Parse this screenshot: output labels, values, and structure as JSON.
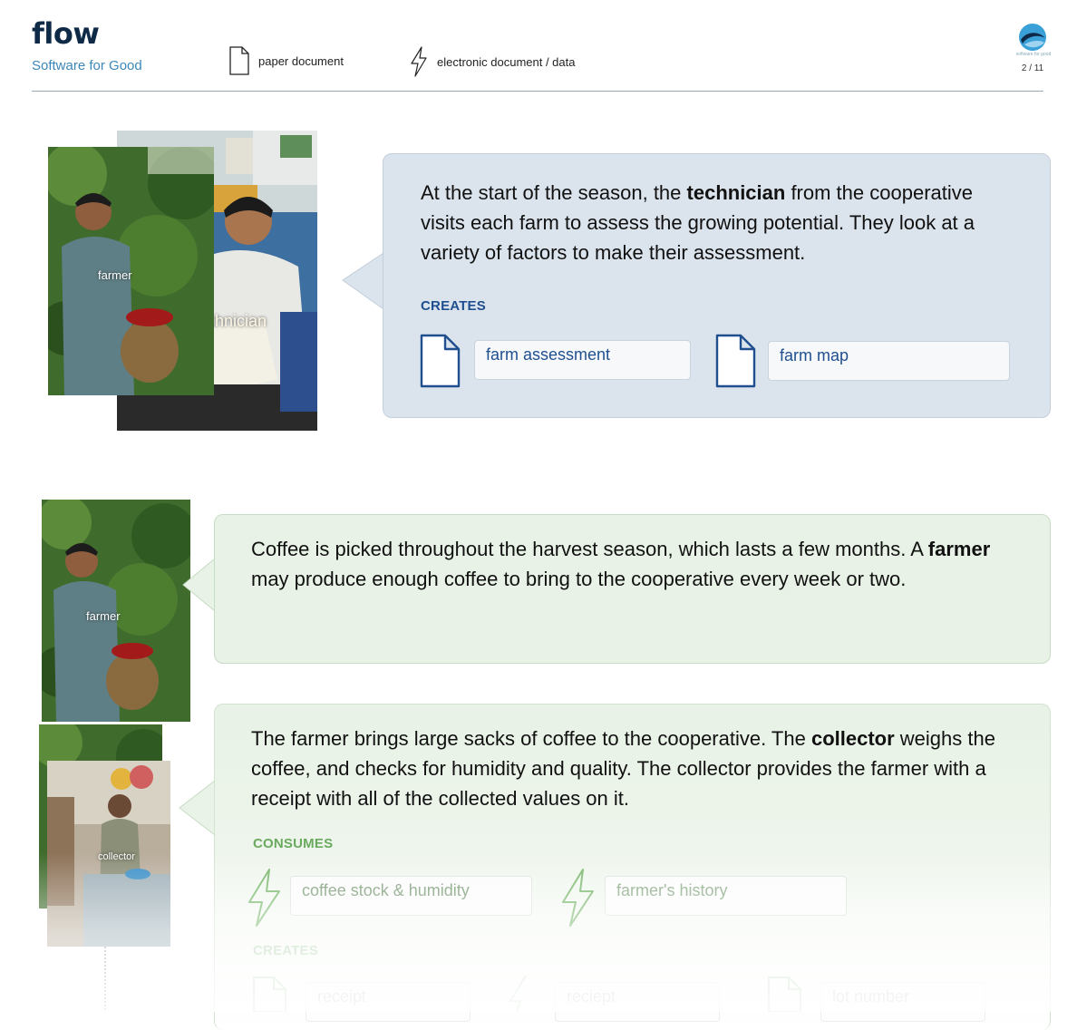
{
  "header": {
    "title": "flow",
    "subtitle": "Software for Good",
    "legend": {
      "paper_label": "paper document",
      "electronic_label": "electronic document / data"
    },
    "brand_tiny": "software for good",
    "page": "2 / 11"
  },
  "step1": {
    "photo_labels": {
      "farmer": "farmer",
      "technician": "technician"
    },
    "text_a": "At the start of the season, the ",
    "role": "technician",
    "text_b": " from the cooperative visits each farm to assess the growing potential. They look at a variety of factors to make their assessment.",
    "creates_label": "CREATES",
    "creates": [
      "farm assessment",
      "farm map"
    ]
  },
  "step2": {
    "photo_label": "farmer",
    "text_a": "Coffee is picked throughout the harvest season, which lasts a few months. A ",
    "role": "farmer",
    "text_b": " may produce enough coffee to bring to the cooperative every week or two."
  },
  "step3": {
    "photo_label": "collector",
    "text_a": "The farmer brings large sacks of coffee to the cooperative. The ",
    "role": "collector",
    "text_b": " weighs the coffee, and checks for humidity and quality. The collector provides the farmer with a receipt with all of the collected values on it.",
    "consumes_label": "CONSUMES",
    "consumes": [
      "coffee stock & humidity",
      "farmer's history"
    ],
    "creates_label": "CREATES",
    "creates": [
      "receipt",
      "reciept",
      "lot number"
    ]
  },
  "colors": {
    "navy": "#0e2a47",
    "blue_accent": "#1f4f8f",
    "green_accent": "#6aaa5e",
    "blue_card": "#dbe3ec",
    "green_card": "#e8f2e6"
  }
}
